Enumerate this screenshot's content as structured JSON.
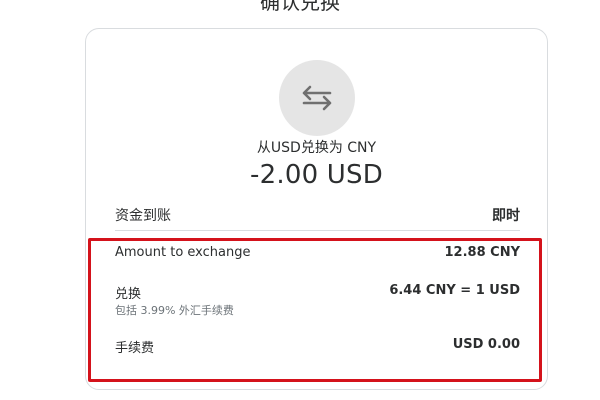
{
  "header": {
    "title_partial": "确认兑换"
  },
  "summary": {
    "icon": "exchange-arrows-icon",
    "subtitle": "从USD兑换为 CNY",
    "amount": "-2.00 USD"
  },
  "funds": {
    "label": "资金到账",
    "value": "即时"
  },
  "details": {
    "amount_to_exchange": {
      "label": "Amount to exchange",
      "value": "12.88 CNY"
    },
    "exchange": {
      "label": "兑换",
      "value": "6.44 CNY = 1 USD",
      "note": "包括 3.99% 外汇手续费"
    },
    "fee": {
      "label": "手续费",
      "value": "USD 0.00"
    }
  },
  "colors": {
    "highlight_border": "#d4121b",
    "circle_bg": "#e5e5e5",
    "text": "#2c2e2f",
    "muted": "#6c7378"
  }
}
